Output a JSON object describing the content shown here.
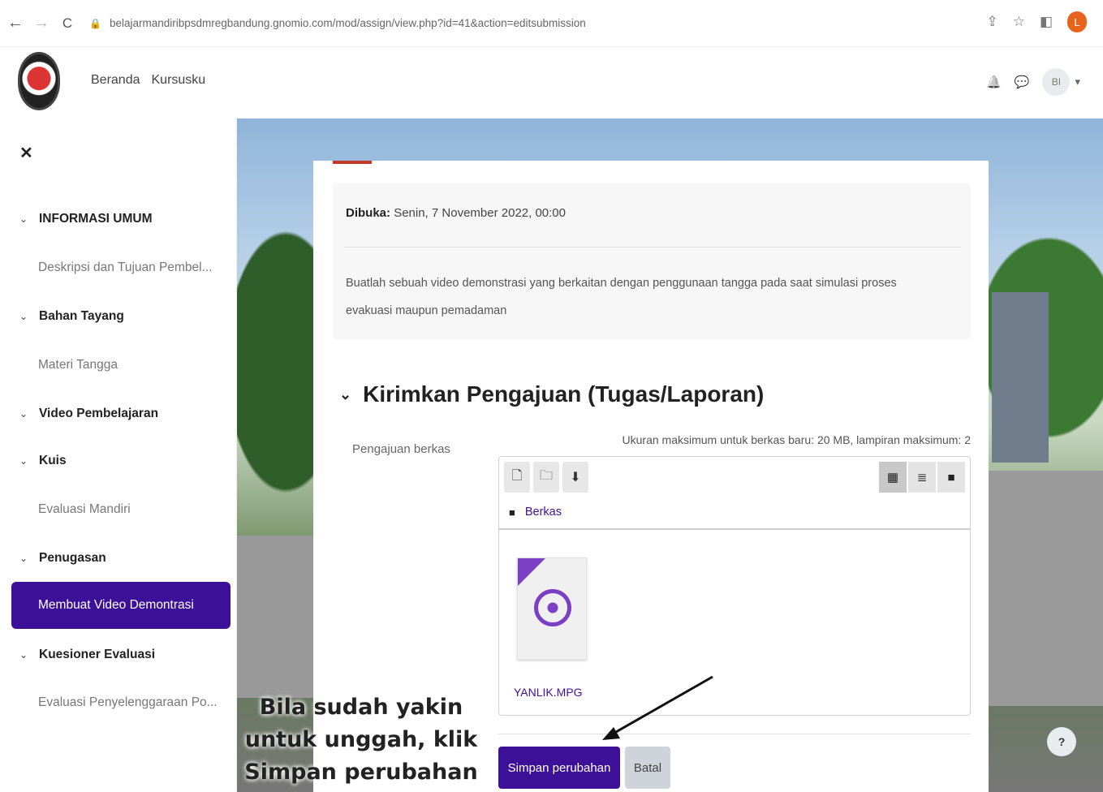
{
  "browser": {
    "url": "belajarmandiribpsdmregbandung.gnomio.com/mod/assign/view.php?id=41&action=editsubmission",
    "back_icon": "←",
    "forward_icon": "→",
    "reload_icon": "C",
    "lock_icon": "🔒",
    "share_icon": "⇪",
    "star_icon": "☆",
    "sidepanel_icon": "◧",
    "profile_initial": "L"
  },
  "header": {
    "nav": [
      "Beranda",
      "Kursusku"
    ],
    "bell_icon": "🔔",
    "chat_icon": "💬",
    "avatar_initials": "BI",
    "avatar_caret": "▾"
  },
  "sidebar": {
    "close_icon": "✕",
    "items": [
      {
        "type": "section",
        "label": "INFORMASI UMUM"
      },
      {
        "type": "link",
        "label": "Deskripsi dan Tujuan Pembel..."
      },
      {
        "type": "section",
        "label": "Bahan Tayang"
      },
      {
        "type": "link",
        "label": "Materi Tangga"
      },
      {
        "type": "section",
        "label": "Video Pembelajaran"
      },
      {
        "type": "section",
        "label": "Kuis"
      },
      {
        "type": "link",
        "label": "Evaluasi Mandiri"
      },
      {
        "type": "section",
        "label": "Penugasan"
      },
      {
        "type": "link",
        "label": "Membuat Video Demontrasi",
        "active": true
      },
      {
        "type": "section",
        "label": "Kuesioner Evaluasi"
      },
      {
        "type": "link",
        "label": "Evaluasi Penyelenggaraan Po..."
      }
    ],
    "chevron": "⌄"
  },
  "assignment": {
    "opened_label": "Dibuka:",
    "opened_value": "Senin, 7 November 2022, 00:00",
    "description": "Buatlah sebuah video demonstrasi yang berkaitan dengan penggunaan tangga pada saat simulasi proses evakuasi maupun pemadaman",
    "section_chevron": "⌄",
    "section_title": "Kirimkan Pengajuan (Tugas/Laporan)",
    "field_label": "Pengajuan berkas",
    "limit_note": "Ukuran maksimum untuk berkas baru: 20 MB, lampiran maksimum: 2",
    "toolbar": {
      "add_file_icon": "🗋",
      "new_folder_icon": "🗀",
      "download_icon": "⬇",
      "icon_view_icon": "▦",
      "list_view_icon": "≣",
      "tree_view_icon": "■"
    },
    "path_folder_icon": "■",
    "path_label": "Berkas",
    "file_name": "YANLIK.MPG",
    "save_label": "Simpan perubahan",
    "cancel_label": "Batal"
  },
  "annotation": {
    "text": "Bila sudah yakin untuk unggah, klik Simpan perubahan"
  },
  "help_label": "?",
  "colors": {
    "brand_purple": "#3d1197",
    "accent_red": "#c0392b",
    "file_icon_purple": "#7b3fc4"
  }
}
